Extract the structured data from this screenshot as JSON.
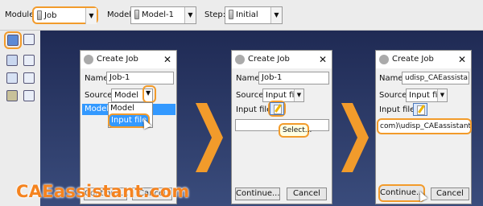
{
  "toolbar": {
    "module_label": "Module:",
    "module_value": "Job",
    "model_label": "Model:",
    "model_value": "Model-1",
    "step_label": "Step:",
    "step_value": "Initial"
  },
  "dialog1": {
    "title": "Create Job",
    "name_label": "Name:",
    "name_value": "Job-1",
    "source_label": "Source:",
    "source_value": "Model",
    "list_item": "Model-",
    "dropdown_options": [
      "Model",
      "Input file"
    ],
    "continue_label": "Continue...",
    "cancel_label": "Cancel"
  },
  "dialog2": {
    "title": "Create Job",
    "name_label": "Name:",
    "name_value": "Job-1",
    "source_label": "Source:",
    "source_value": "Input file",
    "input_file_label": "Input file:",
    "tooltip": "Select...",
    "continue_label": "Continue...",
    "cancel_label": "Cancel"
  },
  "dialog3": {
    "title": "Create Job",
    "name_label": "Name:",
    "name_value": "udisp_CAEassistant",
    "source_label": "Source:",
    "source_value": "Input file",
    "input_file_label": "Input file:",
    "path_value": "com)\\udisp_CAEassistant.inp",
    "continue_label": "Continue...",
    "cancel_label": "Cancel"
  },
  "brand": {
    "text": "CAEassistant.com"
  },
  "colors": {
    "accent_orange": "#f29b2b",
    "viewport_top": "#1f2a54",
    "viewport_bottom": "#3a4c7c",
    "highlight_blue": "#3399ff"
  }
}
